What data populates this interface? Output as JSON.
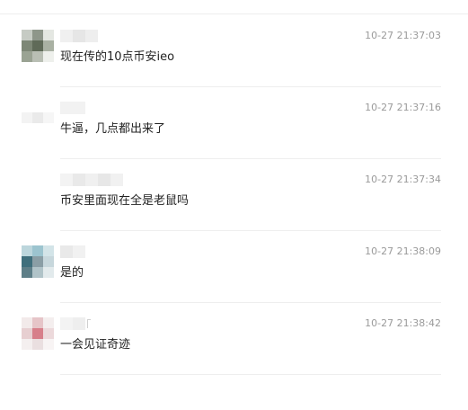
{
  "comments": [
    {
      "timestamp": "10-27 21:37:03",
      "text": "现在传的10点币安ieo"
    },
    {
      "timestamp": "10-27 21:37:16",
      "text": "牛逼，几点都出来了"
    },
    {
      "timestamp": "10-27 21:37:34",
      "text": "币安里面现在全是老鼠吗"
    },
    {
      "timestamp": "10-27 21:38:09",
      "text": "是的"
    },
    {
      "timestamp": "10-27 21:38:42",
      "text": "一会见证奇迹"
    }
  ]
}
